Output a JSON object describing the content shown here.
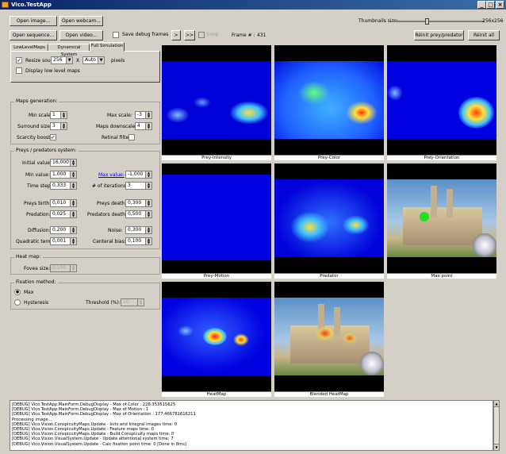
{
  "window": {
    "title": "Vico.TestApp",
    "min": "_",
    "max": "□",
    "close": "×"
  },
  "toolbar": {
    "open_image": "Open image...",
    "open_webcam": "Open webcam...",
    "open_sequence": "Open sequence...",
    "open_video": "Open video...",
    "save_debug_frames": "Save debug frames",
    "play": ">",
    "fast_forward": ">>",
    "loop": "Loop",
    "frame_label": "Frame # :",
    "frame_value": "431",
    "thumbnails_size_label": "Thumbnails size:",
    "thumbnails_size_value": "256x256",
    "thumbnail_slider_level": 0.38,
    "reset_prey_predator": "Réinit prey/predator",
    "reset_all": "Réinit all"
  },
  "tabs": [
    "LowLevelMaps",
    "Dynamical System",
    "Full Simulation"
  ],
  "tab_content": {
    "resize_source": "Resize source",
    "resize_width": "256",
    "resize_x": "X",
    "resize_height": "Auto",
    "pixels": "pixels",
    "display_low_level": "Display low level maps",
    "resize_checked": "✓"
  },
  "maps": {
    "title": "Maps generation:",
    "min_scale_label": "Min scale:",
    "min_scale": "1",
    "max_scale_label": "Max scale:",
    "max_scale": "-3",
    "surround_label": "Surround size:",
    "surround": "3",
    "downscale_label": "Maps downscale:",
    "downscale": "4",
    "scarcity_label": "Scarcity boost:",
    "scarcity_checked": "✓",
    "retinal_label": "Retinal filter:"
  },
  "prey": {
    "title": "Preys / predators system:",
    "initial_label": "Initial value:",
    "initial": "16,000",
    "min_label": "Min value:",
    "min": "1,000",
    "max_label": "Max value:",
    "max": "-1,000",
    "timestep_label": "Time step:",
    "timestep": "0,333",
    "iter_label": "# of iterations:",
    "iter": "3",
    "birth_label": "Preys birth:",
    "birth": "0,010",
    "death_label": "Preys death:",
    "death": "0,300",
    "predation_label": "Predation:",
    "predation": "0,025",
    "pdeath_label": "Predators death:",
    "pdeath": "0,500",
    "diffusion_label": "Diffusion:",
    "diffusion": "0,200",
    "noise_label": "Noise:",
    "noise": "0,300",
    "quadratic_label": "Quadratic term:",
    "quadratic": "0,001",
    "central_label": "Centeral bias:",
    "central": "0,100"
  },
  "heat": {
    "title": "Heat map:",
    "fovea_label": "Fovea size:",
    "fovea": "0,100"
  },
  "fixation": {
    "title": "Fixation method:",
    "max": "Max",
    "hysteresis": "Hysteresis",
    "threshold_label": "Threshold (%):",
    "threshold": "10",
    "radio_on": "●"
  },
  "tiles": [
    "Prey-Intensity",
    "Prey-Color",
    "Prey-Orientation",
    "Prey-Motion",
    "Predator",
    "Max point",
    "HeatMap",
    "Blended HeatMap"
  ],
  "log": [
    "[DEBUG] Vico.TestApp.MainForm.DebugDisplay - Max of Color : 228.353515625",
    "[DEBUG] Vico.TestApp.MainForm.DebugDisplay - Max of Motion : 1",
    "[DEBUG] Vico.TestApp.MainForm.DebugDisplay - Max of Orientation : 177.466781616211",
    "Processing image...",
    "[DEBUG] Vico.Vision.ConspicuityMaps.Update - Inits and Integral images time: 0",
    "[DEBUG] Vico.Vision.ConspicuityMaps.Update - Feature maps time: 0",
    "[DEBUG] Vico.Vision.ConspicuityMaps.Update - Build Conspicuity maps time: 0",
    "[DEBUG] Vico.Vision.VisualSystem.Update - Update attentional system time: 7",
    "[DEBUG] Vico.Vision.VisualSystem.Update - Calc fixation point time: 0   [Done in 8ms]"
  ],
  "icons": {
    "scroll_up": "▲",
    "scroll_down": "▼",
    "spin_up": "▲",
    "spin_down": "▼",
    "dropdown": "▼"
  }
}
